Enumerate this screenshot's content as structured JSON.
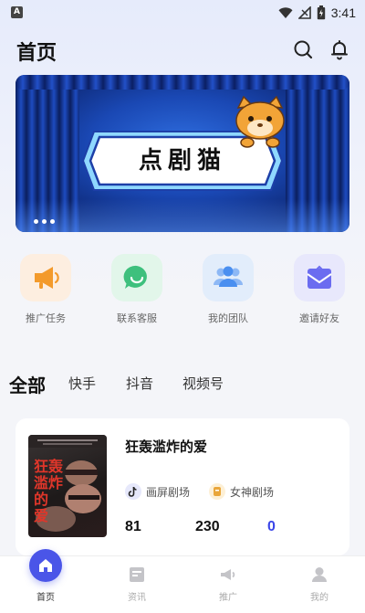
{
  "status_bar": {
    "time": "3:41",
    "app_badge": "A"
  },
  "header": {
    "title": "首页",
    "icons": [
      "search-icon",
      "bell-icon"
    ]
  },
  "banner": {
    "sign_text": "点剧猫",
    "page_count": 3
  },
  "actions": [
    {
      "label": "推广任务",
      "icon": "megaphone-icon",
      "color": "#f39a2b",
      "bg": "#fdeee0"
    },
    {
      "label": "联系客服",
      "icon": "chat-icon",
      "color": "#3ec07d",
      "bg": "#e2f6ea"
    },
    {
      "label": "我的团队",
      "icon": "team-icon",
      "color": "#4a8ff0",
      "bg": "#e2edfb"
    },
    {
      "label": "邀请好友",
      "icon": "mail-icon",
      "color": "#6b6cf0",
      "bg": "#e8e8fc"
    }
  ],
  "tabs": [
    {
      "label": "全部",
      "active": true
    },
    {
      "label": "快手",
      "active": false
    },
    {
      "label": "抖音",
      "active": false
    },
    {
      "label": "视频号",
      "active": false
    }
  ],
  "drama_card": {
    "title": "狂轰滥炸的爱",
    "poster_title": "狂轰\n滥炸\n的\n爱",
    "platforms": [
      {
        "label": "画屏剧场",
        "icon": "tiktok-icon"
      },
      {
        "label": "女神剧场",
        "icon": "theater-icon"
      }
    ],
    "stats": [
      "81",
      "230",
      "0"
    ]
  },
  "bottom_nav": [
    {
      "label": "首页",
      "icon": "home-icon",
      "active": true
    },
    {
      "label": "资讯",
      "icon": "news-icon",
      "active": false
    },
    {
      "label": "推广",
      "icon": "megaphone-icon",
      "active": false
    },
    {
      "label": "我的",
      "icon": "user-icon",
      "active": false
    }
  ],
  "colors": {
    "accent": "#4a55e8",
    "stat_blue": "#3b46e8",
    "banner_blue": "#1a48b4"
  }
}
